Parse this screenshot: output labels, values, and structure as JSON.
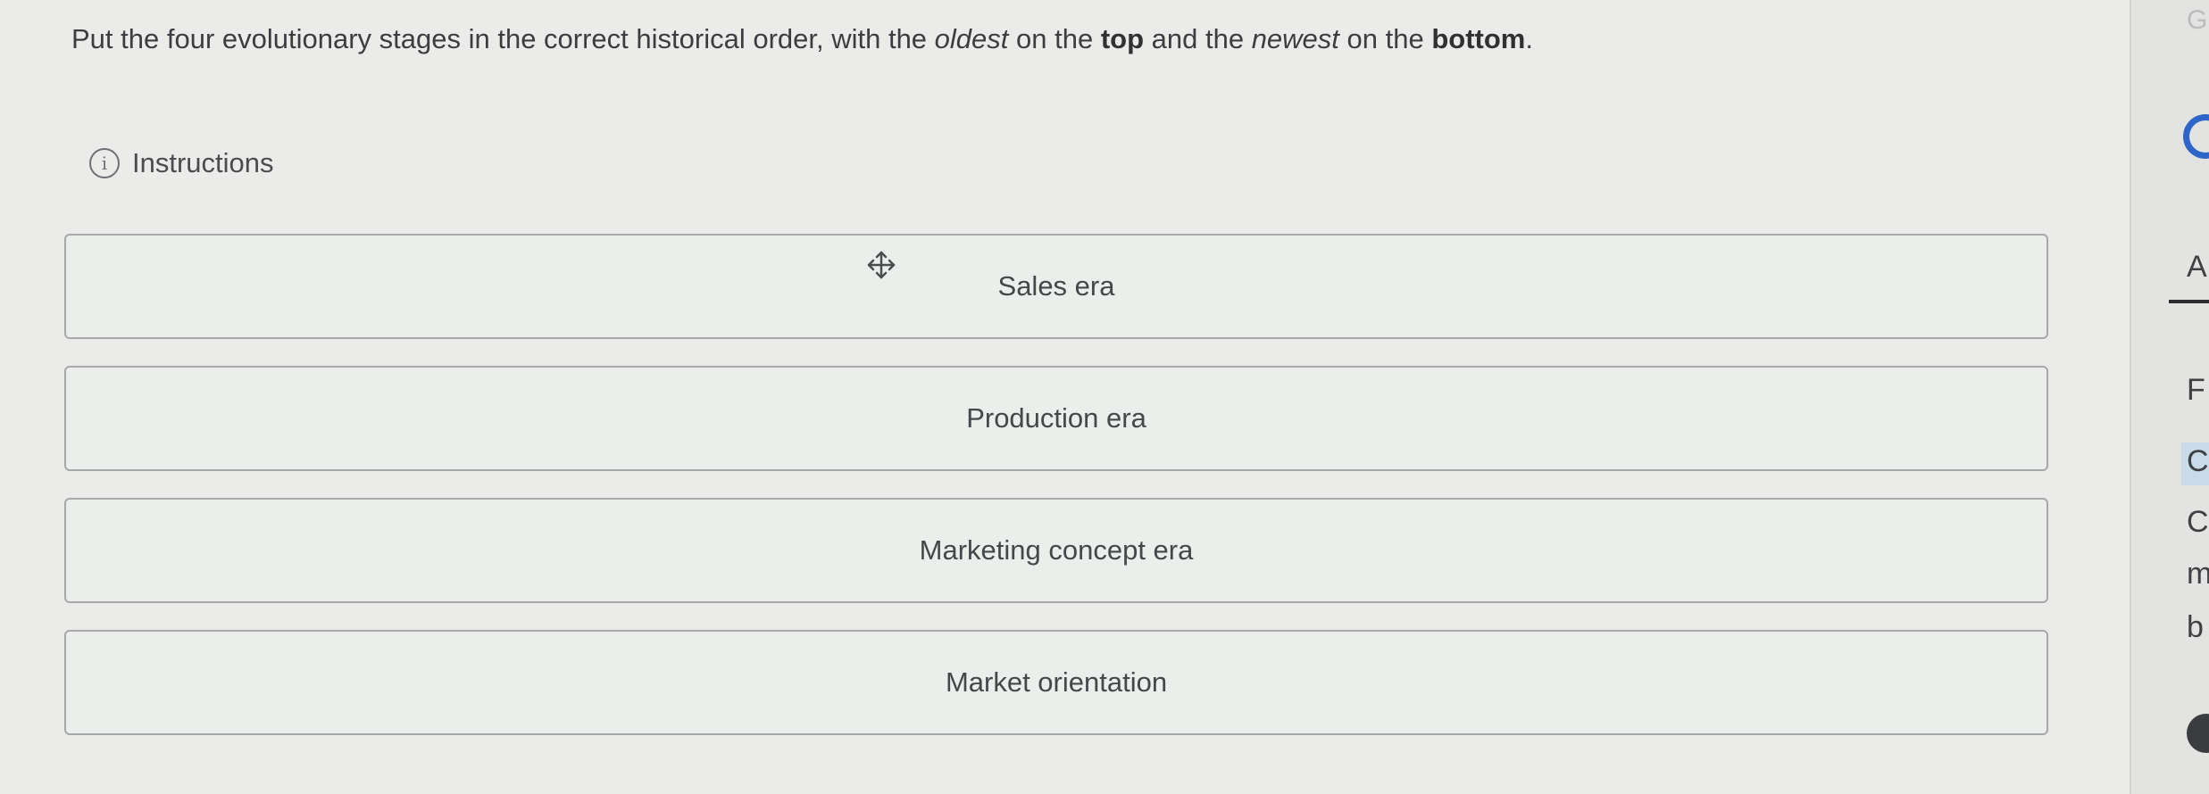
{
  "prompt": {
    "part1": "Put the four evolutionary stages in the correct historical order, with the ",
    "oldest": "oldest",
    "part2": " on the ",
    "top": "top",
    "part3": " and the ",
    "newest": "newest",
    "part4": " on the ",
    "bottom": "bottom",
    "part5": "."
  },
  "instructions": {
    "icon_glyph": "i",
    "label": "Instructions"
  },
  "items": [
    {
      "label": "Sales era"
    },
    {
      "label": "Production era"
    },
    {
      "label": "Marketing concept era"
    },
    {
      "label": "Market orientation"
    }
  ],
  "rightbar": {
    "g_top": "G",
    "a": "A",
    "f": "F",
    "c_highlight": "C",
    "c": "C",
    "m": "m",
    "b": "b"
  },
  "icons": [
    "info-icon",
    "move-icon"
  ]
}
